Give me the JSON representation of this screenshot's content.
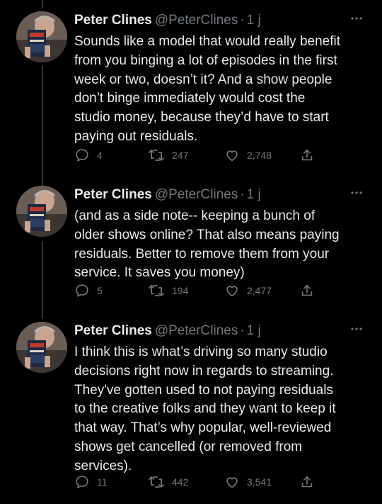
{
  "tweets": [
    {
      "name": "Peter Clines",
      "handle": "@PeterClines",
      "time": "1 j",
      "text": "Sounds like a model that would really benefit\nfrom you binging a lot of episodes in the first\nweek or two, doesn’t it? And a show people\ndon’t binge immediately would cost the\nstudio money, because they’d have to start\npaying out residuals.",
      "replies": "4",
      "retweets": "247",
      "likes": "2,748"
    },
    {
      "name": "Peter Clines",
      "handle": "@PeterClines",
      "time": "1 j",
      "text": "(and as a side note-- keeping a bunch of\nolder shows online? That also means paying\nresiduals. Better to remove them from your\nservice. It saves you money)",
      "replies": "5",
      "retweets": "194",
      "likes": "2,477"
    },
    {
      "name": "Peter Clines",
      "handle": "@PeterClines",
      "time": "1 j",
      "text": "I think this is what’s driving so many studio\ndecisions right now in regards to streaming.\nThey've gotten used to not paying residuals\nto the creative folks and they want to keep it\nthat way. That’s why popular, well-reviewed\nshows get cancelled (or removed from\nservices).",
      "replies": "11",
      "retweets": "442",
      "likes": "3,541"
    }
  ],
  "icons": {
    "reply": "reply-icon",
    "retweet": "retweet-icon",
    "like": "like-icon",
    "share": "share-icon",
    "more": "more-icon"
  },
  "colors": {
    "background": "#000000",
    "text": "#e7e9ea",
    "secondary": "#71767b",
    "thread_line": "#333639"
  }
}
